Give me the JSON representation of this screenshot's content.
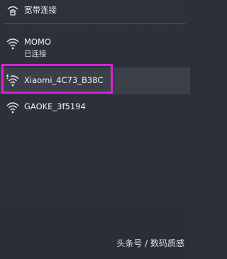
{
  "wired": {
    "label": "宽带连接"
  },
  "networks": [
    {
      "name": "MOMO",
      "status": "已连接"
    },
    {
      "name": "Xiaomi_4C73_B38C"
    },
    {
      "name": "GAOKE_3f5194"
    }
  ],
  "watermark": "头条号 / 数码质感",
  "colors": {
    "background": "#2b2f38",
    "selected_row": "#3a3f48",
    "highlight": "#d623d6"
  }
}
